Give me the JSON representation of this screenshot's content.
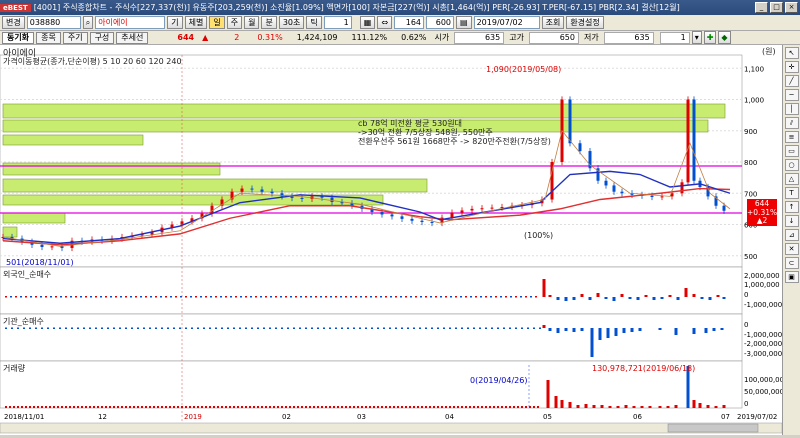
{
  "titlebar": {
    "logo": "eBEST",
    "title": "[4001] 주식종합차트 - 주식수[227,337(천)] 유동주[203,259(천)] 소진율[1.09%] 액면가[100] 자본금[227(억)] 시총[1,464(억)] PER[-26.93] T.PER[-67.15] PBR[2.34] 결산[12월]",
    "buttons": [
      "_",
      "□",
      "×"
    ]
  },
  "toolbar1": {
    "change_btn": "변경",
    "code": "038880",
    "name": "아이에이",
    "period_buttons": [
      "기",
      "체별",
      "일",
      "주",
      "월",
      "분",
      "30초",
      "틱"
    ],
    "count1": "1",
    "count2": "164",
    "count3": "600",
    "date": "2019/07/02",
    "query_btn": "조회",
    "settings_btn": "환경설정"
  },
  "toolbar2": {
    "tabs": [
      "동기화",
      "종목",
      "주기",
      "구성",
      "추세선"
    ],
    "price": "644",
    "arrow": "▲",
    "change": "2",
    "change_pct": "0.31%",
    "volume": "1,424,109",
    "vol_ratio": "111.12%",
    "turnover": "0.62%",
    "open_label": "시가",
    "open": "635",
    "high_label": "고가",
    "high": "650",
    "low_label": "저가",
    "low": "635",
    "spin_value": "1"
  },
  "panes": {
    "title": "아이에이",
    "unit": "(원)",
    "price_label": "가격이동평균(종가,단순이평) 5 10 20 60 120 240",
    "foreign_label": "외국인_순매수",
    "inst_label": "기관_순매수",
    "volume_label": "거래량"
  },
  "annotations": {
    "high_marker": "1,090(2019/05/08)",
    "low_marker": "501(2018/11/01)",
    "note1": "cb 78억 미전환 평균 530원대",
    "note2": "->30억 전환 7/5상장 548원, 550만주",
    "note3": "전환우선주 561원 1668만주 -> 820만주전환(7/5상장)",
    "max_vol": "130,978,721(2019/06/18)",
    "zero_vol": "0(2019/04/26)",
    "current_price_tag": "644",
    "current_change_tag": "+0.31%",
    "current_change_tag2": "▲2",
    "mid_label": "(100%)"
  },
  "price_axis": [
    "1,100",
    "1,000",
    "900",
    "800",
    "700",
    "600",
    "500"
  ],
  "foreign_axis": [
    "2,000,000",
    "1,000,000",
    "0",
    "-1,000,000"
  ],
  "inst_axis": [
    "0",
    "-1,000,000",
    "-2,000,000",
    "-3,000,000"
  ],
  "volume_axis": [
    "100,000,000",
    "50,000,000",
    "0"
  ],
  "x_axis": [
    "2018/11/01",
    "12",
    "2019",
    "02",
    "03",
    "04",
    "05",
    "06",
    "07",
    "2019/07/02"
  ],
  "colors": {
    "bg": "#ffffff",
    "up": "#e00000",
    "down": "#0050d0",
    "ma_red": "#e03030",
    "ma_blue": "#2030c0",
    "box_green": "#c8ec70",
    "box_border": "#7a9a30",
    "magenta": "#e000e0"
  },
  "chart_data": {
    "type": "candlestick",
    "title": "아이에이",
    "ylabel": "(원)",
    "ylim": [
      480,
      1120
    ],
    "x": [
      "2018/11/01",
      "2018/12",
      "2019/01",
      "2019/02",
      "2019/03",
      "2019/04",
      "2019/05",
      "2019/06",
      "2019/07/02"
    ],
    "close_approx": [
      501,
      540,
      590,
      700,
      680,
      595,
      900,
      720,
      644
    ],
    "high_marker": {
      "date": "2019/05/08",
      "value": 1090
    },
    "low_marker": {
      "date": "2018/11/01",
      "value": 501
    },
    "last": {
      "date": "2019/07/02",
      "value": 644,
      "change": 2,
      "change_pct": 0.31
    },
    "volume_max": {
      "date": "2019/06/18",
      "value": 130978721
    }
  }
}
